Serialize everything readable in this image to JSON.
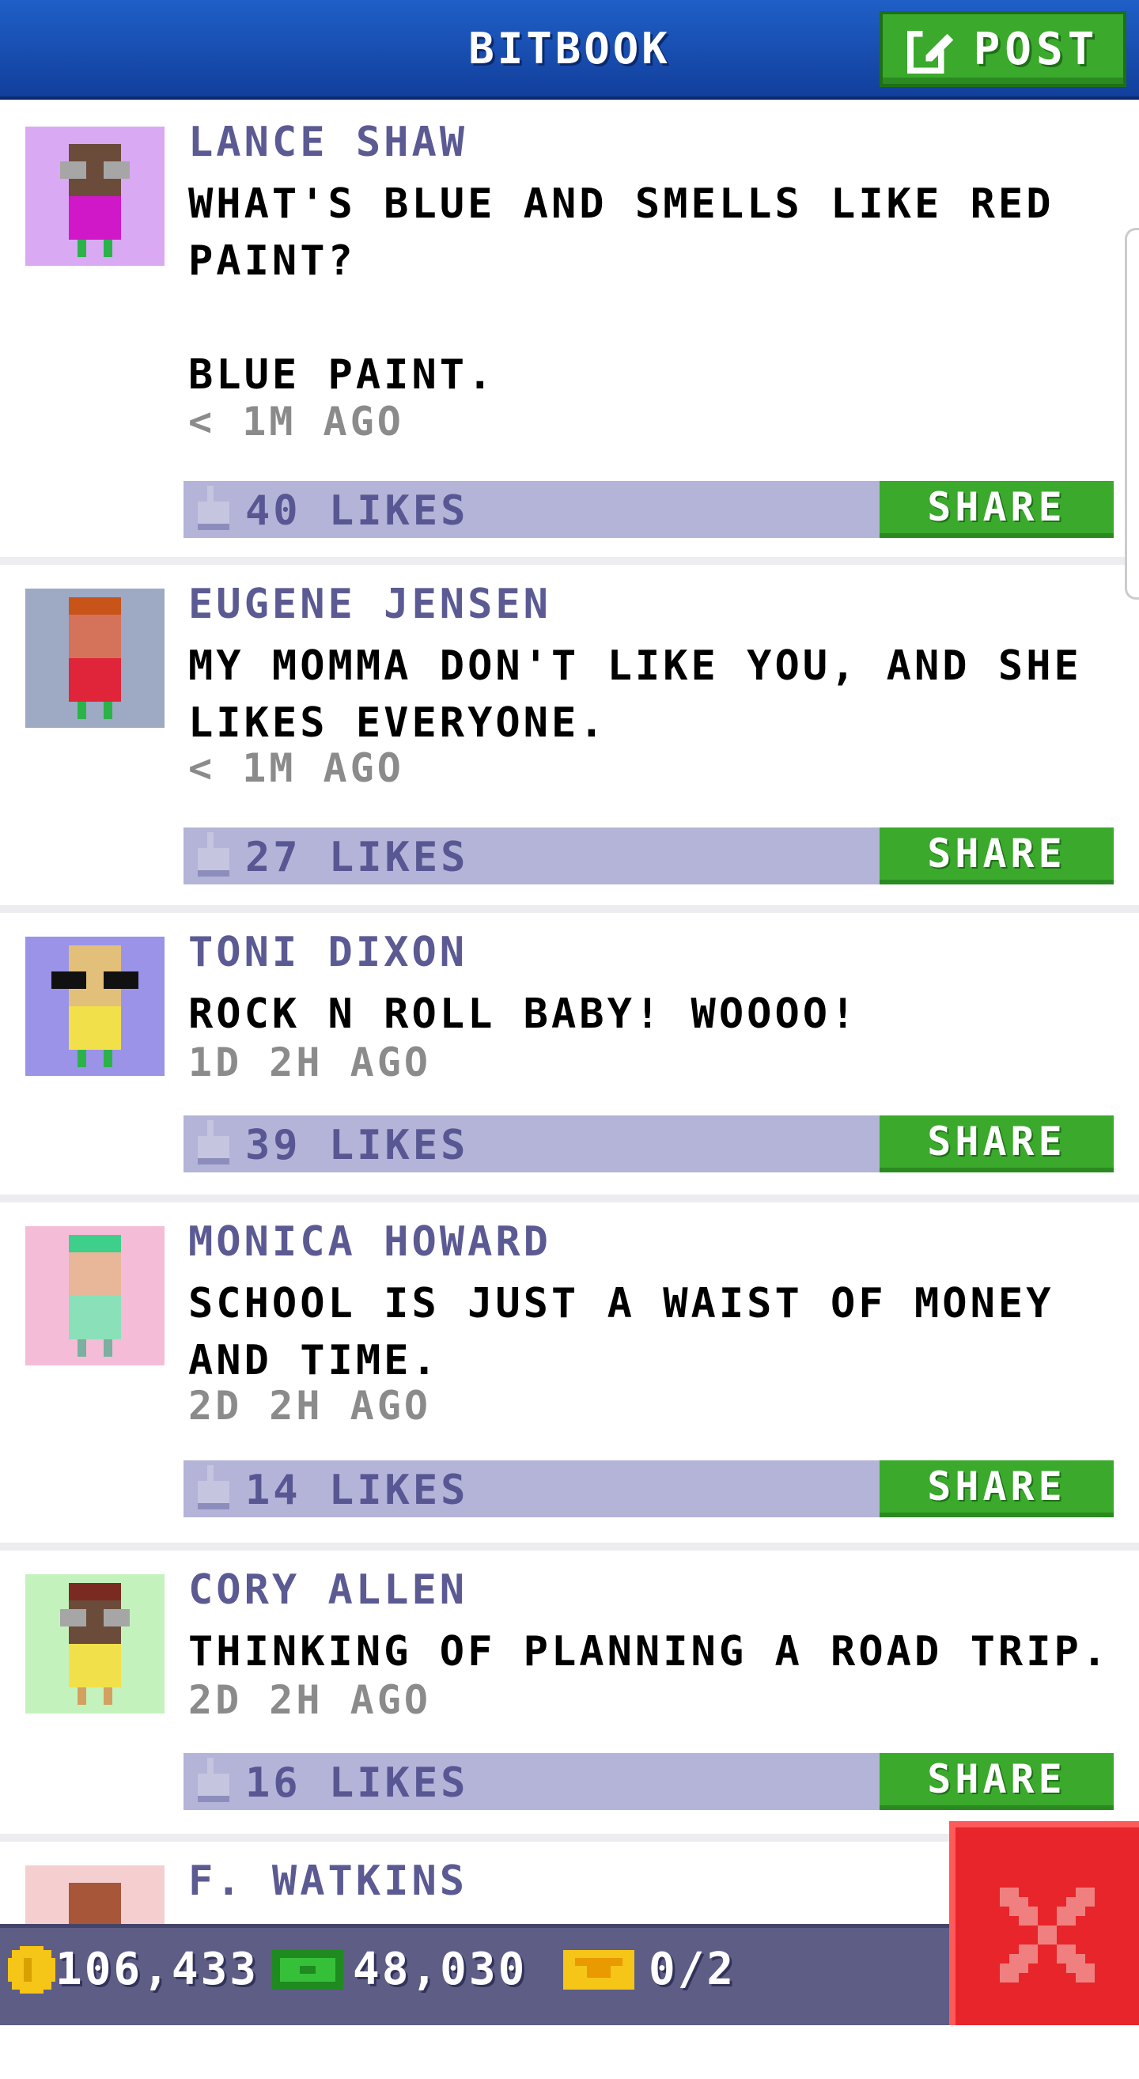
{
  "header": {
    "title": "BITBOOK",
    "post_label": "POST"
  },
  "posts": [
    {
      "author": "LANCE SHAW",
      "message": "WHAT'S BLUE AND SMELLS LIKE RED\nPAINT?\n\nBLUE PAINT.",
      "time": "< 1M AGO",
      "likes": "40 LIKES",
      "share": "SHARE",
      "avatar_bg": "#d9a9f4"
    },
    {
      "author": "EUGENE JENSEN",
      "message": "MY MOMMA DON'T LIKE YOU, AND SHE\nLIKES EVERYONE.",
      "time": "< 1M AGO",
      "likes": "27 LIKES",
      "share": "SHARE",
      "avatar_bg": "#9ea9c4"
    },
    {
      "author": "TONI DIXON",
      "message": "ROCK N ROLL BABY! WOOOO!",
      "time": "1D 2H AGO",
      "likes": "39 LIKES",
      "share": "SHARE",
      "avatar_bg": "#9b93e8"
    },
    {
      "author": "MONICA HOWARD",
      "message": "SCHOOL IS JUST A WAIST OF MONEY\nAND TIME.",
      "time": "2D 2H AGO",
      "likes": "14 LIKES",
      "share": "SHARE",
      "avatar_bg": "#f5bcd8"
    },
    {
      "author": "CORY ALLEN",
      "message": "THINKING OF PLANNING A ROAD TRIP.",
      "time": "2D 2H AGO",
      "likes": "16 LIKES",
      "share": "SHARE",
      "avatar_bg": "#c4f2bd"
    },
    {
      "author": "F. WATKINS",
      "avatar_bg": "#f5cfcf"
    }
  ],
  "bottom": {
    "coins": "106,433",
    "cash": "48,030",
    "tickets": "0/2"
  },
  "colors": {
    "header": "#1a4fb3",
    "share_green": "#3aa92c",
    "likes_bar": "#b4b4d8",
    "close_red": "#e8252a"
  },
  "icons": {
    "post": "edit-icon",
    "like": "thumbs-up-icon",
    "coin": "coin-icon",
    "cash": "cash-icon",
    "ticket": "ticket-icon",
    "close": "close-icon"
  }
}
